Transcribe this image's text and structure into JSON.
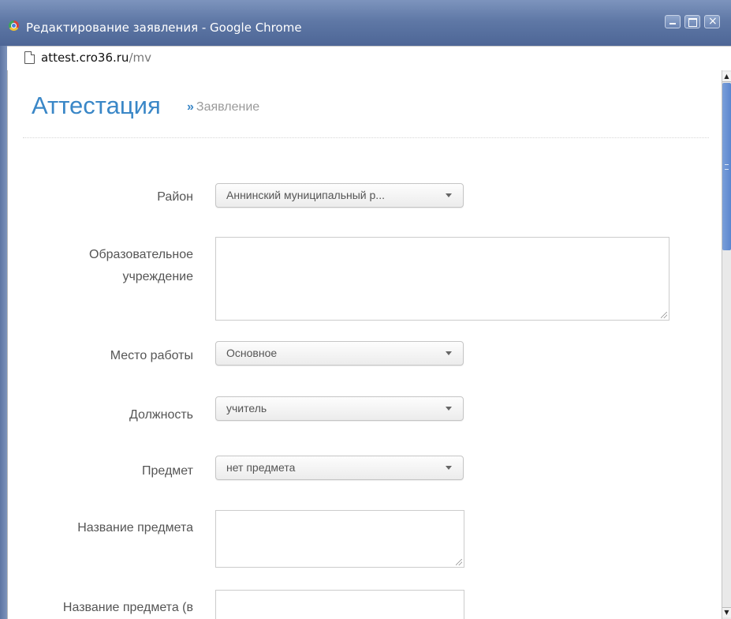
{
  "window": {
    "title": "Редактирование заявления - Google Chrome",
    "url_host": "attest.cro36.ru",
    "url_path": "/mv"
  },
  "page": {
    "heading": "Аттестация",
    "breadcrumb_sep": "»",
    "breadcrumb": "Заявление"
  },
  "form": {
    "rayon": {
      "label": "Район",
      "value": "Аннинский муниципальный р..."
    },
    "institution": {
      "label_line1": "Образовательное",
      "label_line2": "учреждение",
      "value": ""
    },
    "workplace": {
      "label": "Место работы",
      "value": "Основное"
    },
    "position": {
      "label": "Должность",
      "value": "учитель"
    },
    "subject": {
      "label": "Предмет",
      "value": "нет предмета"
    },
    "subject_name": {
      "label": "Название предмета",
      "value": ""
    },
    "subject_name2": {
      "label": "Название предмета (в",
      "value": ""
    }
  },
  "icons": {
    "browser": "chrome-logo-icon",
    "page": "page-icon",
    "min": "minimize-icon",
    "max": "maximize-icon",
    "close": "close-icon"
  }
}
